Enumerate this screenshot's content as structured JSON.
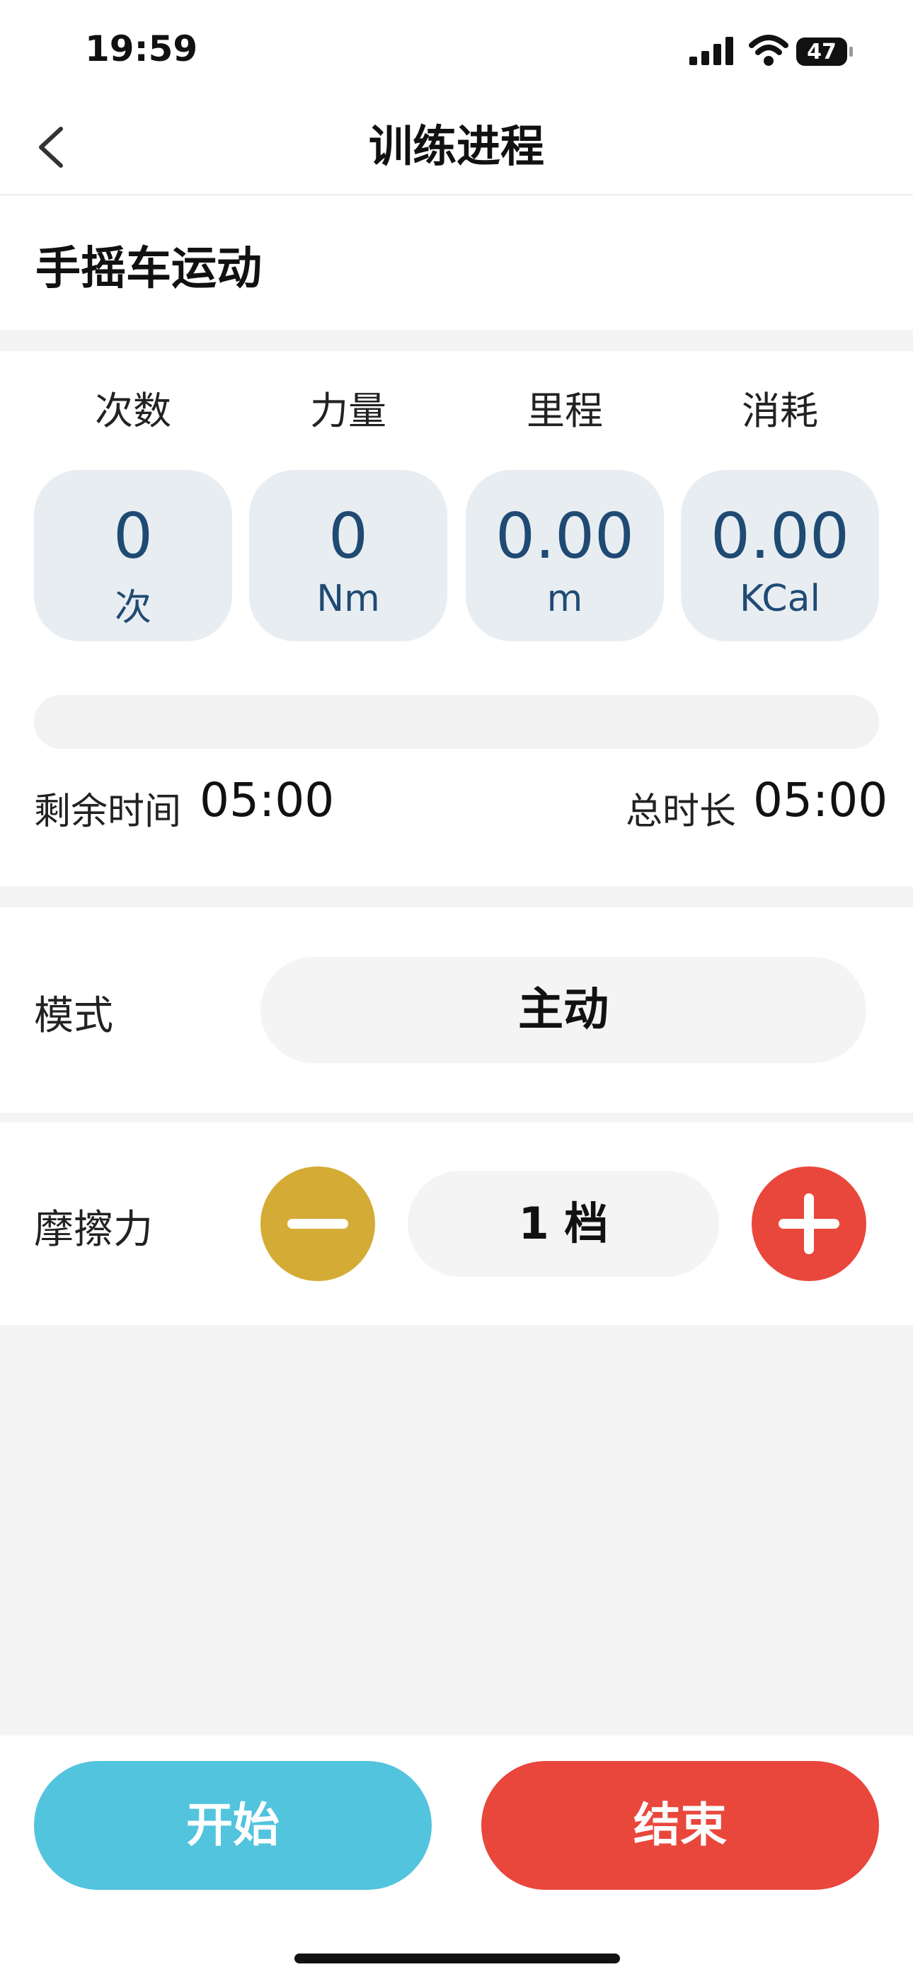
{
  "status_bar": {
    "time": "19:59",
    "battery": "47"
  },
  "nav": {
    "title": "训练进程"
  },
  "exercise": {
    "name": "手摇车运动"
  },
  "stats": [
    {
      "label": "次数",
      "value": "0",
      "unit": "次"
    },
    {
      "label": "力量",
      "value": "0",
      "unit": "Nm"
    },
    {
      "label": "里程",
      "value": "0.00",
      "unit": "m"
    },
    {
      "label": "消耗",
      "value": "0.00",
      "unit": "KCal"
    }
  ],
  "progress": {
    "fraction": 0
  },
  "timer": {
    "remaining_label": "剩余时间",
    "remaining_value": "05:00",
    "total_label": "总时长",
    "total_value": "05:00"
  },
  "mode": {
    "label": "模式",
    "value": "主动"
  },
  "friction": {
    "label": "摩擦力",
    "value": "1 档"
  },
  "actions": {
    "start": "开始",
    "end": "结束"
  },
  "colors": {
    "accent_blue": "#52c4de",
    "danger_red": "#e9473c",
    "minus_yellow": "#d4ab35",
    "stat_text": "#1f4a73",
    "stat_bg": "#e8edf2"
  },
  "icons": {
    "back": "chevron-left-icon",
    "minus": "minus-icon",
    "plus": "plus-icon",
    "signal": "signal-icon",
    "wifi": "wifi-icon",
    "battery": "battery-icon"
  }
}
